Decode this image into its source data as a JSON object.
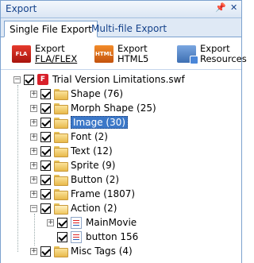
{
  "panel": {
    "title": "Export"
  },
  "tabs": [
    {
      "label": "Single File Export",
      "active": true
    },
    {
      "label": "Multi-file Export",
      "active": false
    }
  ],
  "toolbar": [
    {
      "icon": "fla-export-icon",
      "line1": "Export",
      "line2": "FLA/FLEX",
      "badge": "FLA"
    },
    {
      "icon": "html5-export-icon",
      "line1": "Export",
      "line2": "HTML5",
      "badge": "HTML"
    },
    {
      "icon": "resources-export-icon",
      "line1": "Export",
      "line2": "Resources"
    }
  ],
  "tree": {
    "root": "Trial Version Limitations.swf",
    "root_badge": "F",
    "items": [
      "Shape (76)",
      "Morph Shape (25)",
      "Image (30)",
      "Font (2)",
      "Text (12)",
      "Sprite (9)",
      "Button (2)",
      "Frame (1807)",
      "Action (2)",
      "MainMovie",
      "button 156",
      "Misc Tags (4)"
    ],
    "selected": "Image (30)"
  }
}
